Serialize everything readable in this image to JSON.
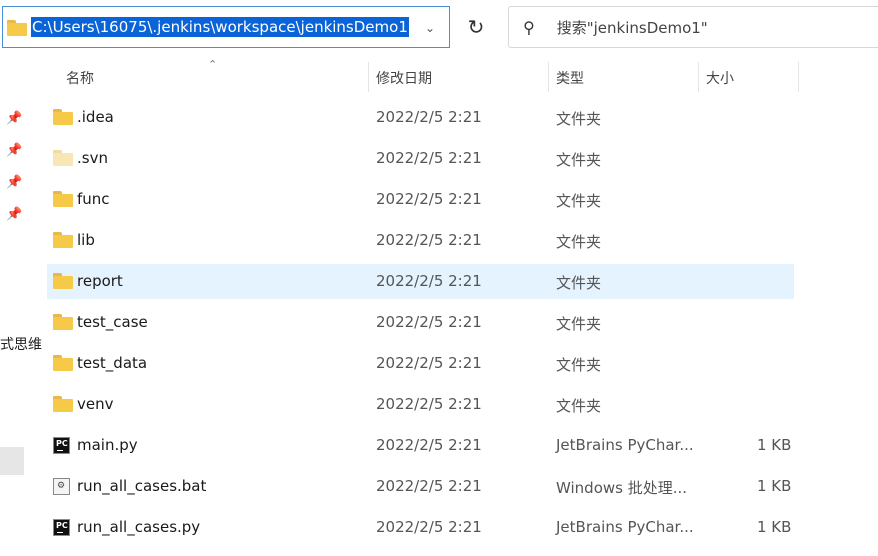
{
  "address": {
    "path": "C:\\Users\\16075\\.jenkins\\workspace\\jenkinsDemo1",
    "dropdown_icon": "chevron-down-icon",
    "refresh_icon": "refresh-icon"
  },
  "search": {
    "placeholder": "搜索\"jenkinsDemo1\"",
    "icon": "search-icon"
  },
  "sidebar": {
    "cut_text": "式思维"
  },
  "columns": {
    "name": "名称",
    "date": "修改日期",
    "type": "类型",
    "size": "大小"
  },
  "files": [
    {
      "name": ".idea",
      "date": "2022/2/5 2:21",
      "type": "文件夹",
      "size": "",
      "icon": "folder-icon"
    },
    {
      "name": ".svn",
      "date": "2022/2/5 2:21",
      "type": "文件夹",
      "size": "",
      "icon": "hidden-folder-icon"
    },
    {
      "name": "func",
      "date": "2022/2/5 2:21",
      "type": "文件夹",
      "size": "",
      "icon": "folder-icon"
    },
    {
      "name": "lib",
      "date": "2022/2/5 2:21",
      "type": "文件夹",
      "size": "",
      "icon": "folder-icon"
    },
    {
      "name": "report",
      "date": "2022/2/5 2:21",
      "type": "文件夹",
      "size": "",
      "icon": "folder-icon",
      "selected": true
    },
    {
      "name": "test_case",
      "date": "2022/2/5 2:21",
      "type": "文件夹",
      "size": "",
      "icon": "folder-icon"
    },
    {
      "name": "test_data",
      "date": "2022/2/5 2:21",
      "type": "文件夹",
      "size": "",
      "icon": "folder-icon"
    },
    {
      "name": "venv",
      "date": "2022/2/5 2:21",
      "type": "文件夹",
      "size": "",
      "icon": "folder-icon"
    },
    {
      "name": "main.py",
      "date": "2022/2/5 2:21",
      "type": "JetBrains PyChar...",
      "size": "1 KB",
      "icon": "pycharm-file-icon"
    },
    {
      "name": "run_all_cases.bat",
      "date": "2022/2/5 2:21",
      "type": "Windows 批处理...",
      "size": "1 KB",
      "icon": "batch-file-icon"
    },
    {
      "name": "run_all_cases.py",
      "date": "2022/2/5 2:21",
      "type": "JetBrains PyChar...",
      "size": "1 KB",
      "icon": "pycharm-file-icon"
    }
  ],
  "colors": {
    "selection": "#e5f3ff",
    "address_highlight": "#0a64d8",
    "folder": "#f7c948"
  }
}
